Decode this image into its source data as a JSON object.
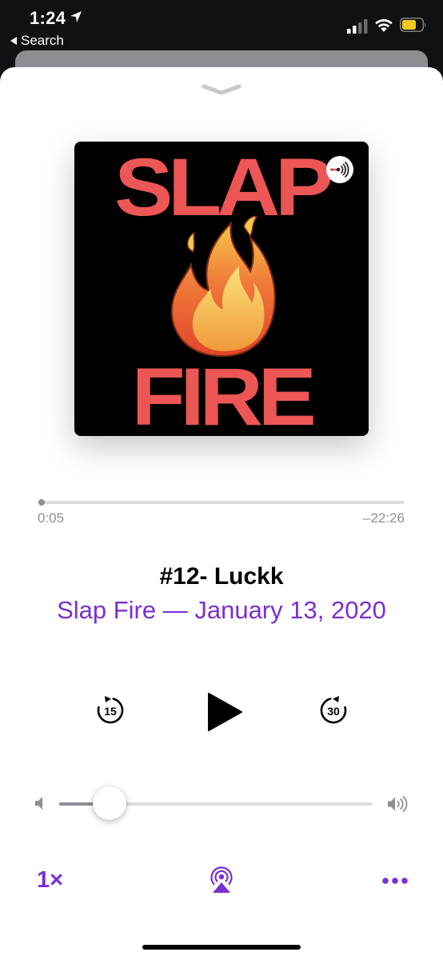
{
  "status_bar": {
    "time": "1:24",
    "back_label": "Search"
  },
  "artwork": {
    "top_text": "SLAP",
    "bottom_text": "FIRE",
    "text_color": "#ec5654",
    "background": "#000000"
  },
  "progress": {
    "elapsed": "0:05",
    "remaining": "–22:26",
    "fraction": 0.004
  },
  "episode": {
    "title": "#12- Luckk",
    "subtitle": "Slap Fire — January 13, 2020"
  },
  "controls": {
    "skip_back_seconds": "15",
    "skip_forward_seconds": "30",
    "play_icon": "play-icon"
  },
  "volume": {
    "level": 0.14
  },
  "bottom_bar": {
    "speed_label": "1×",
    "airplay_icon": "airplay-icon",
    "more_icon": "more-icon"
  },
  "colors": {
    "accent": "#7b2fd1",
    "secondary_text": "#8e8e93"
  }
}
